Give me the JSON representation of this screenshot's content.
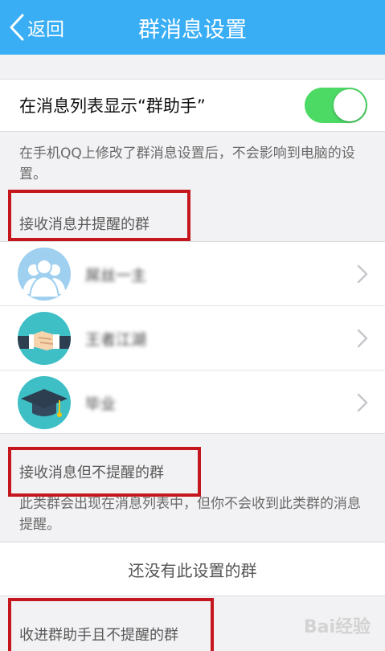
{
  "header": {
    "back_label": "返回",
    "title": "群消息设置",
    "bg_color": "#3aaef5"
  },
  "toggle": {
    "label": "在消息列表显示“群助手”",
    "on": true,
    "color": "#4cd964"
  },
  "notes": {
    "settings_note": "在手机QQ上修改了群消息设置后，不会影响到电脑的设置。",
    "section2_note": "此类群会出现在消息列表中，但你不会收到此类群的消息提醒。"
  },
  "sections": {
    "notify": "接收消息并提醒的群",
    "no_notify": "接收消息但不提醒的群",
    "helper_no_notify": "收进群助手且不提醒的群"
  },
  "groups": [
    {
      "name": "屌丝一主",
      "avatar_icon": "people-icon",
      "avatar_color": "#9fd0ef"
    },
    {
      "name": "王者江湖",
      "avatar_icon": "handshake-icon",
      "avatar_color": "#3dbfc5"
    },
    {
      "name": "毕业",
      "avatar_icon": "graduation-cap-icon",
      "avatar_color": "#3dbfc5"
    }
  ],
  "empty_text": "还没有此设置的群",
  "watermark": "Bai经验",
  "highlight_color": "#c4161c"
}
